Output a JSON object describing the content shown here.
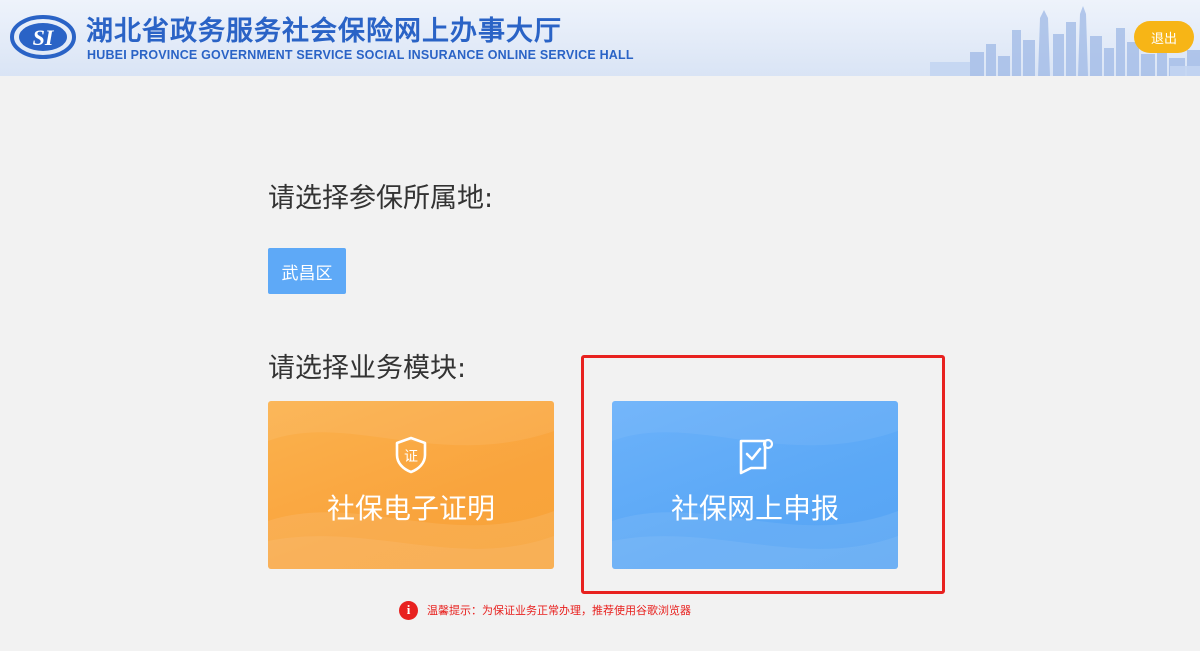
{
  "header": {
    "title_cn": "湖北省政务服务社会保险网上办事大厅",
    "title_en": "HUBEI PROVINCE GOVERNMENT SERVICE SOCIAL INSURANCE ONLINE SERVICE HALL",
    "logo_text": "SI",
    "logout_label": "退出"
  },
  "region_section": {
    "title": "请选择参保所属地:",
    "selected_region": "武昌区"
  },
  "module_section": {
    "title": "请选择业务模块:",
    "modules": [
      {
        "label": "社保电子证明",
        "icon": "certificate-shield-icon",
        "icon_char": "证",
        "color": "#f9a63f"
      },
      {
        "label": "社保网上申报",
        "icon": "document-check-icon",
        "color": "#5ba8f6"
      }
    ]
  },
  "tip": {
    "icon": "info-icon",
    "text": "温馨提示：为保证业务正常办理，推荐使用谷歌浏览器"
  },
  "colors": {
    "brand_blue": "#2a63c6",
    "logout_yellow": "#f7b516",
    "region_blue": "#5ea9f7",
    "highlight_red": "#e8211f"
  }
}
